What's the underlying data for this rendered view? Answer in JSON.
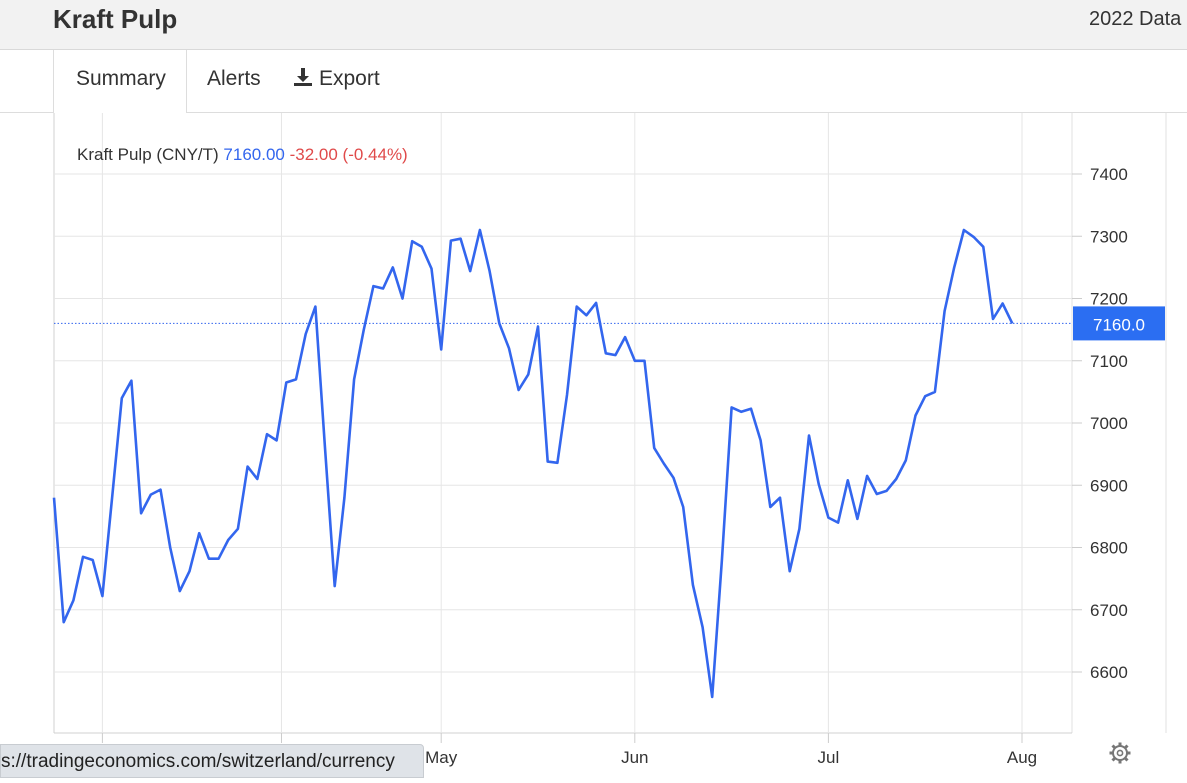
{
  "header": {
    "title": "Kraft Pulp",
    "year_label": "2022 Data"
  },
  "tabs": {
    "summary": "Summary",
    "alerts": "Alerts",
    "export": "Export"
  },
  "legend": {
    "name": "Kraft Pulp (CNY/T)",
    "value": "7160.00",
    "change": "-32.00 (-0.44%)"
  },
  "price_tag": "7160.0",
  "status_url": "s://tradingeconomics.com/switzerland/currency",
  "colors": {
    "line": "#3366ee",
    "negative": "#e04a4a",
    "tag_bg": "#2b6ef2"
  },
  "chart_data": {
    "type": "line",
    "title": "",
    "xlabel": "",
    "ylabel": "",
    "ylim": [
      6520,
      7440
    ],
    "yticks": [
      6600,
      6700,
      6800,
      6900,
      7000,
      7100,
      7200,
      7300,
      7400
    ],
    "ytick_labels": [
      "6600",
      "6700",
      "6800",
      "6900",
      "7000",
      "7100",
      "7200",
      "7300",
      "7400"
    ],
    "xticks": [
      {
        "label": "May",
        "index": 40
      },
      {
        "label": "Jun",
        "index": 60
      },
      {
        "label": "Jul",
        "index": 80
      },
      {
        "label": "Aug",
        "index": 100
      }
    ],
    "last_value": 7160,
    "series": [
      {
        "values": [
          6880,
          6680,
          6715,
          6785,
          6780,
          6722,
          6880,
          7040,
          7068,
          6855,
          6885,
          6893,
          6800,
          6730,
          6762,
          6823,
          6782,
          6782,
          6812,
          6830,
          6930,
          6910,
          6982,
          6972,
          7065,
          7070,
          7143,
          7187,
          6960,
          6738,
          6880,
          7070,
          7150,
          7220,
          7216,
          7250,
          7200,
          7292,
          7283,
          7248,
          7118,
          7293,
          7296,
          7244,
          7310,
          7244,
          7160,
          7120,
          7053,
          7078,
          7155,
          6938,
          6936,
          7045,
          7187,
          7173,
          7193,
          7112,
          7109,
          7138,
          7100,
          7100,
          6960,
          6935,
          6912,
          6865,
          6740,
          6672,
          6560,
          6780,
          7025,
          7018,
          7023,
          6972,
          6865,
          6880,
          6762,
          6830,
          6980,
          6902,
          6848,
          6840,
          6908,
          6846,
          6915,
          6886,
          6891,
          6910,
          6940,
          7012,
          7043,
          7050,
          7180,
          7250,
          7310,
          7299,
          7283,
          7167,
          7192,
          7160
        ]
      }
    ]
  }
}
